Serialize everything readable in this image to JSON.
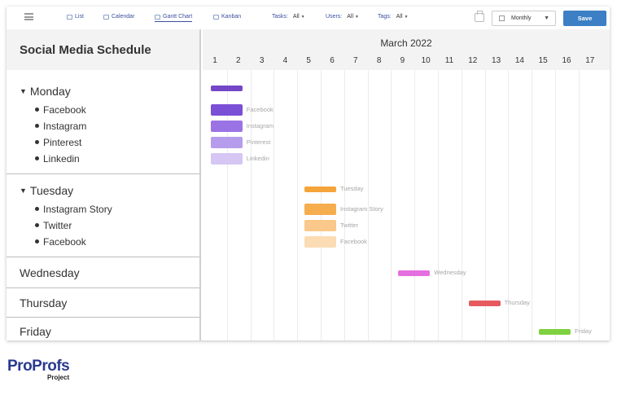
{
  "toolbar": {
    "views": [
      {
        "label": "List",
        "icon": "list-icon"
      },
      {
        "label": "Calendar",
        "icon": "calendar-icon"
      },
      {
        "label": "Gantt Chart",
        "icon": "gantt-icon",
        "active": true
      },
      {
        "label": "Kanban",
        "icon": "kanban-icon"
      }
    ],
    "filters": [
      {
        "label": "Tasks:",
        "value": "All"
      },
      {
        "label": "Users:",
        "value": "All"
      },
      {
        "label": "Tags:",
        "value": "All"
      }
    ],
    "period": "Monthly",
    "save_label": "Save"
  },
  "panel": {
    "title": "Social Media Schedule",
    "groups": [
      {
        "name": "Monday",
        "expanded": true,
        "items": [
          "Facebook",
          "Instagram",
          "Pinterest",
          "Linkedin"
        ]
      },
      {
        "name": "Tuesday",
        "expanded": true,
        "items": [
          "Instagram Story",
          "Twitter",
          "Facebook"
        ]
      },
      {
        "name": "Wednesday",
        "expanded": false,
        "items": []
      },
      {
        "name": "Thursday",
        "expanded": false,
        "items": []
      },
      {
        "name": "Friday",
        "expanded": false,
        "items": []
      }
    ]
  },
  "gantt": {
    "month": "March 2022",
    "days": [
      "1",
      "2",
      "3",
      "4",
      "5",
      "6",
      "7",
      "8",
      "9",
      "10",
      "11",
      "12",
      "13",
      "14",
      "15",
      "16",
      "17"
    ],
    "bars": [
      {
        "label": "",
        "start": 1,
        "end": 2,
        "color": "#7547c8"
      },
      {
        "label": "Facebook",
        "start": 1,
        "end": 2,
        "color": "#7a50d6"
      },
      {
        "label": "Instagram",
        "start": 1,
        "end": 2,
        "color": "#9a73e4"
      },
      {
        "label": "Pinterest",
        "start": 1,
        "end": 2,
        "color": "#b69cec"
      },
      {
        "label": "Linkedin",
        "start": 1,
        "end": 2,
        "color": "#d5c6f4"
      },
      {
        "label": "Tuesday",
        "start": 5,
        "end": 6,
        "color": "#f4a43a"
      },
      {
        "label": "Instagram Story",
        "start": 5,
        "end": 6,
        "color": "#f6ad4e"
      },
      {
        "label": "Twitter",
        "start": 5,
        "end": 6,
        "color": "#f9c88a"
      },
      {
        "label": "Facebook",
        "start": 5,
        "end": 6,
        "color": "#fcdcb4"
      },
      {
        "label": "Wednesday",
        "start": 9,
        "end": 10,
        "color": "#e46fe0"
      },
      {
        "label": "Thursday",
        "start": 12,
        "end": 13,
        "color": "#e65a5f"
      },
      {
        "label": "Friday",
        "start": 15,
        "end": 16,
        "color": "#7ed13f"
      }
    ]
  },
  "logo": {
    "main": "ProProfs",
    "sub": "Project"
  }
}
